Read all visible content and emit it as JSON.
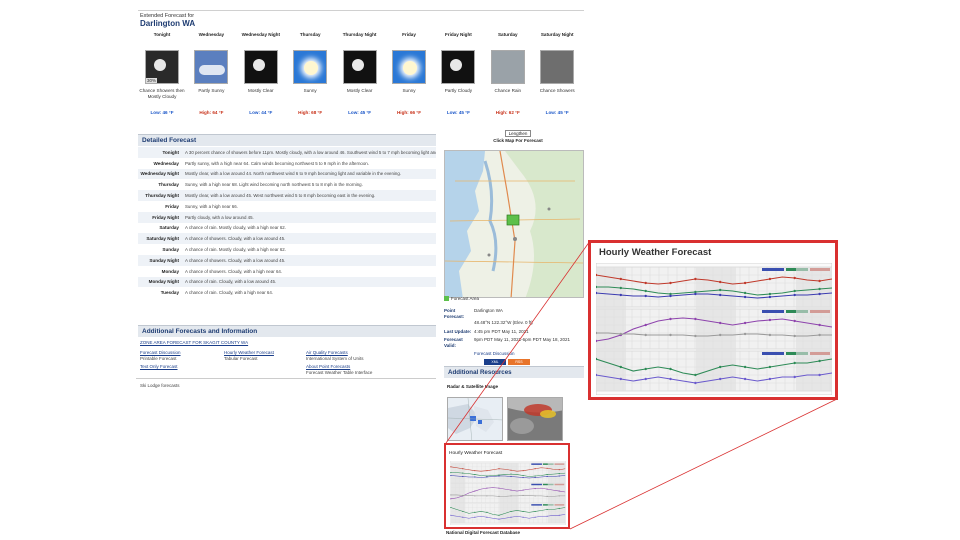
{
  "header": {
    "small_label": "Extended Forecast for",
    "city": "Darlington WA"
  },
  "forecast_periods": [
    {
      "name": "Tonight",
      "desc": "Chance Showers then Mostly Cloudy",
      "temp": "Low: 46 °F",
      "type": "low",
      "icon": "chance-showers-night-icon",
      "pct": "30%"
    },
    {
      "name": "Wednesday",
      "desc": "Partly Sunny",
      "temp": "High: 64 °F",
      "type": "high",
      "icon": "partly-sunny-icon",
      "pct": ""
    },
    {
      "name": "Wednesday Night",
      "desc": "Mostly Clear",
      "temp": "Low: 44 °F",
      "type": "low",
      "icon": "mostly-clear-night-icon",
      "pct": ""
    },
    {
      "name": "Thursday",
      "desc": "Sunny",
      "temp": "High: 68 °F",
      "type": "high",
      "icon": "sunny-icon",
      "pct": ""
    },
    {
      "name": "Thursday Night",
      "desc": "Mostly Clear",
      "temp": "Low: 45 °F",
      "type": "low",
      "icon": "mostly-clear-night-icon",
      "pct": ""
    },
    {
      "name": "Friday",
      "desc": "Sunny",
      "temp": "High: 66 °F",
      "type": "high",
      "icon": "sunny-icon",
      "pct": ""
    },
    {
      "name": "Friday Night",
      "desc": "Partly Cloudy",
      "temp": "Low: 45 °F",
      "type": "low",
      "icon": "partly-cloudy-night-icon",
      "pct": ""
    },
    {
      "name": "Saturday",
      "desc": "Chance Rain",
      "temp": "High: 62 °F",
      "type": "high",
      "icon": "chance-rain-icon",
      "pct": ""
    },
    {
      "name": "Saturday Night",
      "desc": "Chance Showers",
      "temp": "Low: 45 °F",
      "type": "low",
      "icon": "chance-showers-icon",
      "pct": ""
    }
  ],
  "detailed": {
    "heading": "Detailed Forecast",
    "rows": [
      {
        "period": "Tonight",
        "text": "A 30 percent chance of showers before 11pm. Mostly cloudy, with a low around 46. Southwest wind 5 to 7 mph becoming light and variable in the evening."
      },
      {
        "period": "Wednesday",
        "text": "Partly sunny, with a high near 64. Calm winds becoming northwest 5 to 9 mph in the afternoon."
      },
      {
        "period": "Wednesday Night",
        "text": "Mostly clear, with a low around 44. North northwest wind 6 to 9 mph becoming light and variable in the evening."
      },
      {
        "period": "Thursday",
        "text": "Sunny, with a high near 68. Light wind becoming north northwest 5 to 8 mph in the morning."
      },
      {
        "period": "Thursday Night",
        "text": "Mostly clear, with a low around 45. West northwest wind 5 to 8 mph becoming east in the evening."
      },
      {
        "period": "Friday",
        "text": "Sunny, with a high near 66."
      },
      {
        "period": "Friday Night",
        "text": "Partly cloudy, with a low around 45."
      },
      {
        "period": "Saturday",
        "text": "A chance of rain. Mostly cloudy, with a high near 62."
      },
      {
        "period": "Saturday Night",
        "text": "A chance of showers. Cloudy, with a low around 45."
      },
      {
        "period": "Sunday",
        "text": "A chance of rain. Mostly cloudy, with a high near 62."
      },
      {
        "period": "Sunday Night",
        "text": "A chance of showers. Cloudy, with a low around 45."
      },
      {
        "period": "Monday",
        "text": "A chance of showers. Cloudy, with a high near 64."
      },
      {
        "period": "Monday Night",
        "text": "A chance of rain. Cloudy, with a low around 45."
      },
      {
        "period": "Tuesday",
        "text": "A chance of rain. Cloudy, with a high near 64."
      }
    ]
  },
  "additional": {
    "heading": "Additional Forecasts and Information",
    "top_line": "ZONE AREA FORECAST FOR SKAGIT COUNTY WA",
    "links": [
      {
        "label": "Forecast Discussion",
        "sub": "Printable Forecast"
      },
      {
        "label": "Hourly Weather Forecast",
        "sub": "Tabular Forecast"
      },
      {
        "label": "Air Quality Forecasts",
        "sub": "International System of Units"
      },
      {
        "label": "Text Only Forecast",
        "sub": ""
      },
      {
        "label": "About Point Forecasts",
        "sub": "Forecast Weather Table Interface"
      }
    ],
    "bottom_text": "Ski Lodge forecasts"
  },
  "map": {
    "select_label": "Lengthen",
    "click_label": "Click Map For Forecast",
    "legend_text": "Forecast Area"
  },
  "point_info": {
    "point_label": "Point Forecast:",
    "point_value": "Darlington WA",
    "point_coords": "48.48°N 122.32°W (Elev. 0 ft)",
    "last_update_label": "Last Update:",
    "last_update_value": "4:45 pm PDT May 11, 2021",
    "forecast_valid_label": "Forecast Valid:",
    "forecast_valid_value": "9pm PDT May 11, 2021-6pm PDT May 18, 2021",
    "discussion": "Forecast Discussion",
    "badge_xml": "XML",
    "badge_rss": "RSS"
  },
  "resources": {
    "heading": "Additional Resources",
    "sub": "Radar & Satellite Image",
    "hourly_small_title": "Hourly Weather Forecast",
    "ndfd_caption": "National Digital Forecast Database"
  },
  "zoom": {
    "title": "Hourly Weather Forecast"
  },
  "colors": {
    "accent": "#1e3c72",
    "callout": "#d93030",
    "temp_line": "#c0392b",
    "dew_line": "#2e8b57",
    "wind_line": "#3b3bb0",
    "humidity_line": "#8e44ad",
    "precip_line": "#6a5acd"
  }
}
